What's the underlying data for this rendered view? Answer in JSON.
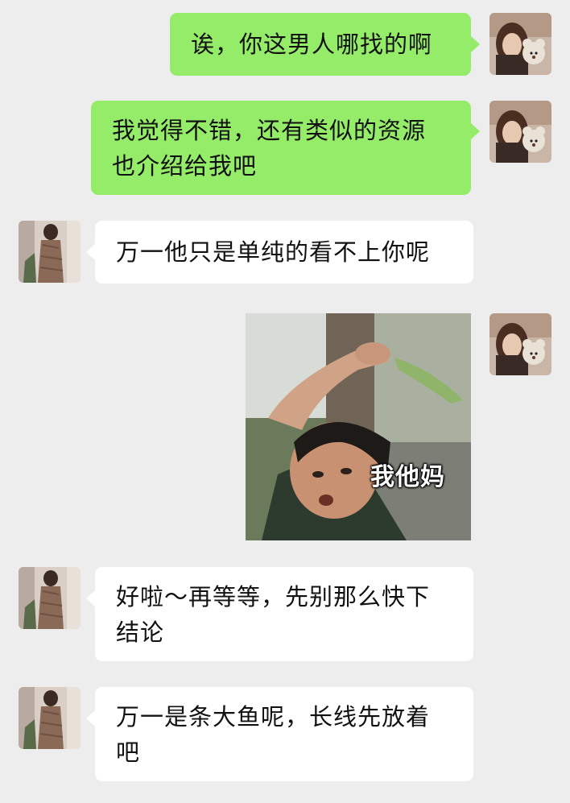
{
  "messages": [
    {
      "side": "right",
      "text": "诶，你这男人哪找的啊"
    },
    {
      "side": "right",
      "text_line1": "我觉得不错，还有类似的资源",
      "text_line2": "也介绍给我吧"
    },
    {
      "side": "left",
      "text": "万一他只是单纯的看不上你呢"
    },
    {
      "side": "right",
      "type": "sticker",
      "sticker_text": "我他妈"
    },
    {
      "side": "left",
      "text_line1": "好啦～再等等，先别那么快下",
      "text_line2": "结论"
    },
    {
      "side": "left",
      "text_line1": "万一是条大鱼呢，长线先放着",
      "text_line2": "吧"
    }
  ],
  "colors": {
    "background": "#ededed",
    "sent_bubble": "#95ec69",
    "received_bubble": "#ffffff"
  }
}
